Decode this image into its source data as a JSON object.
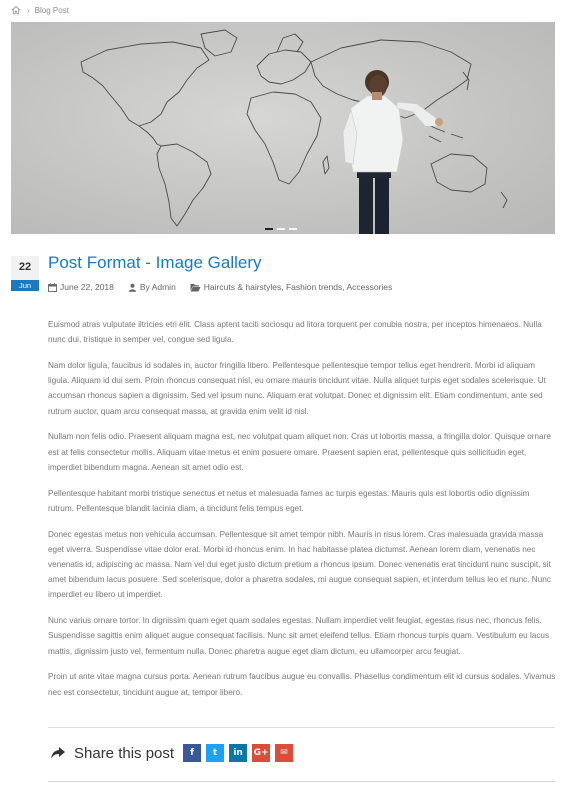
{
  "breadcrumb": {
    "current": "Blog Post",
    "separator": "›"
  },
  "gallery": {
    "slide_count": 3,
    "active_index": 0
  },
  "post": {
    "day": "22",
    "month": "Jun",
    "title": "Post Format - Image Gallery",
    "date": "June 22, 2018",
    "author": "By Admin",
    "categories": "Haircuts & hairstyles, Fashion trends, Accessories"
  },
  "content": {
    "paragraphs": [
      "Euismod atras vulputate iltricies etri elit. Class aptent taciti sociosqu ad litora torquent per conubia nostra, per inceptos himenaeos. Nulla nunc dui, tristique in semper vel, congue sed ligula.",
      "Nam dolor ligula, faucibus id sodales in, auctor fringilla libero. Pellentesque pellentesque tempor tellus eget hendrerit. Morbi id aliquam ligula. Aliquam id dui sem. Proin rhoncus consequat nisl, eu ornare mauris tincidunt vitae. Nulla aliquet turpis eget sodales scelerisque. Ut accumsan rhoncus sapien a dignissim. Sed vel ipsum nunc. Aliquam erat volutpat. Donec et dignissim elit. Etiam condimentum, ante sed rutrum auctor, quam arcu consequat massa, at gravida enim velit id nisl.",
      "Nullam non felis odio. Praesent aliquam magna est, nec volutpat quam aliquet non. Cras ut lobortis massa, a fringilla dolor. Quisque ornare est at felis consectetur mollis. Aliquam vitae metus et enim posuere ornare. Praesent sapien erat, pellentesque quis sollicitudin eget, imperdiet bibendum magna. Aenean sit amet odio est.",
      "Pellentesque habitant morbi tristique senectus et netus et malesuada fames ac turpis egestas. Mauris quis est lobortis odio dignissim rutrum. Pellentesque blandit lacinia diam, a tincidunt felis tempus eget.",
      "Donec egestas metus non vehicula accumsan. Pellentesque sit amet tempor nibh. Mauris in risus lorem. Cras malesuada gravida massa eget viverra. Suspendisse vitae dolor erat. Morbi id rhoncus enim. In hac habitasse platea dictumst. Aenean lorem diam, venenatis nec venenatis id, adipiscing ac massa. Nam vel dui eget justo dictum pretium a rhoncus ipsum. Donec venenatis erat tincidunt nunc suscipit, sit amet bibendum lacus posuere. Sed scelerisque, dolor a pharetra sodales, mi augue consequat sapien, et interdum tellus leo et nunc. Nunc imperdiet eu libero ut imperdiet.",
      "Nunc varius ornare tortor. In dignissim quam eget quam sodales egestas. Nullam imperdiet velit feugiat, egestas risus nec, rhoncus felis. Suspendisse sagittis enim aliquet augue consequat facilisis. Nunc sit amet eleifend tellus. Etiam rhoncus turpis quam. Vestibulum eu lacus mattis, dignissim justo vel, fermentum nulla. Donec pharetra augue eget diam dictum, eu ullamcorper arcu feugiat.",
      "Proin ut ante vitae magna cursus porta. Aenean rutrum faucibus augue eu convallis. Phasellus condimentum elit id cursus sodales. Vivamus nec est consectetur, tincidunt augue at, tempor libero."
    ]
  },
  "share": {
    "label": "Share this post",
    "buttons": [
      {
        "name": "facebook",
        "glyph": "f",
        "color": "#3b5998"
      },
      {
        "name": "twitter",
        "glyph": "t",
        "color": "#1da1f2"
      },
      {
        "name": "linkedin",
        "glyph": "in",
        "color": "#0e76a8"
      },
      {
        "name": "google-plus",
        "glyph": "G+",
        "color": "#dd4b39"
      },
      {
        "name": "email",
        "glyph": "✉",
        "color": "#dd4b39"
      }
    ]
  },
  "colors": {
    "accent": "#1a7ac0",
    "text": "#777777"
  }
}
